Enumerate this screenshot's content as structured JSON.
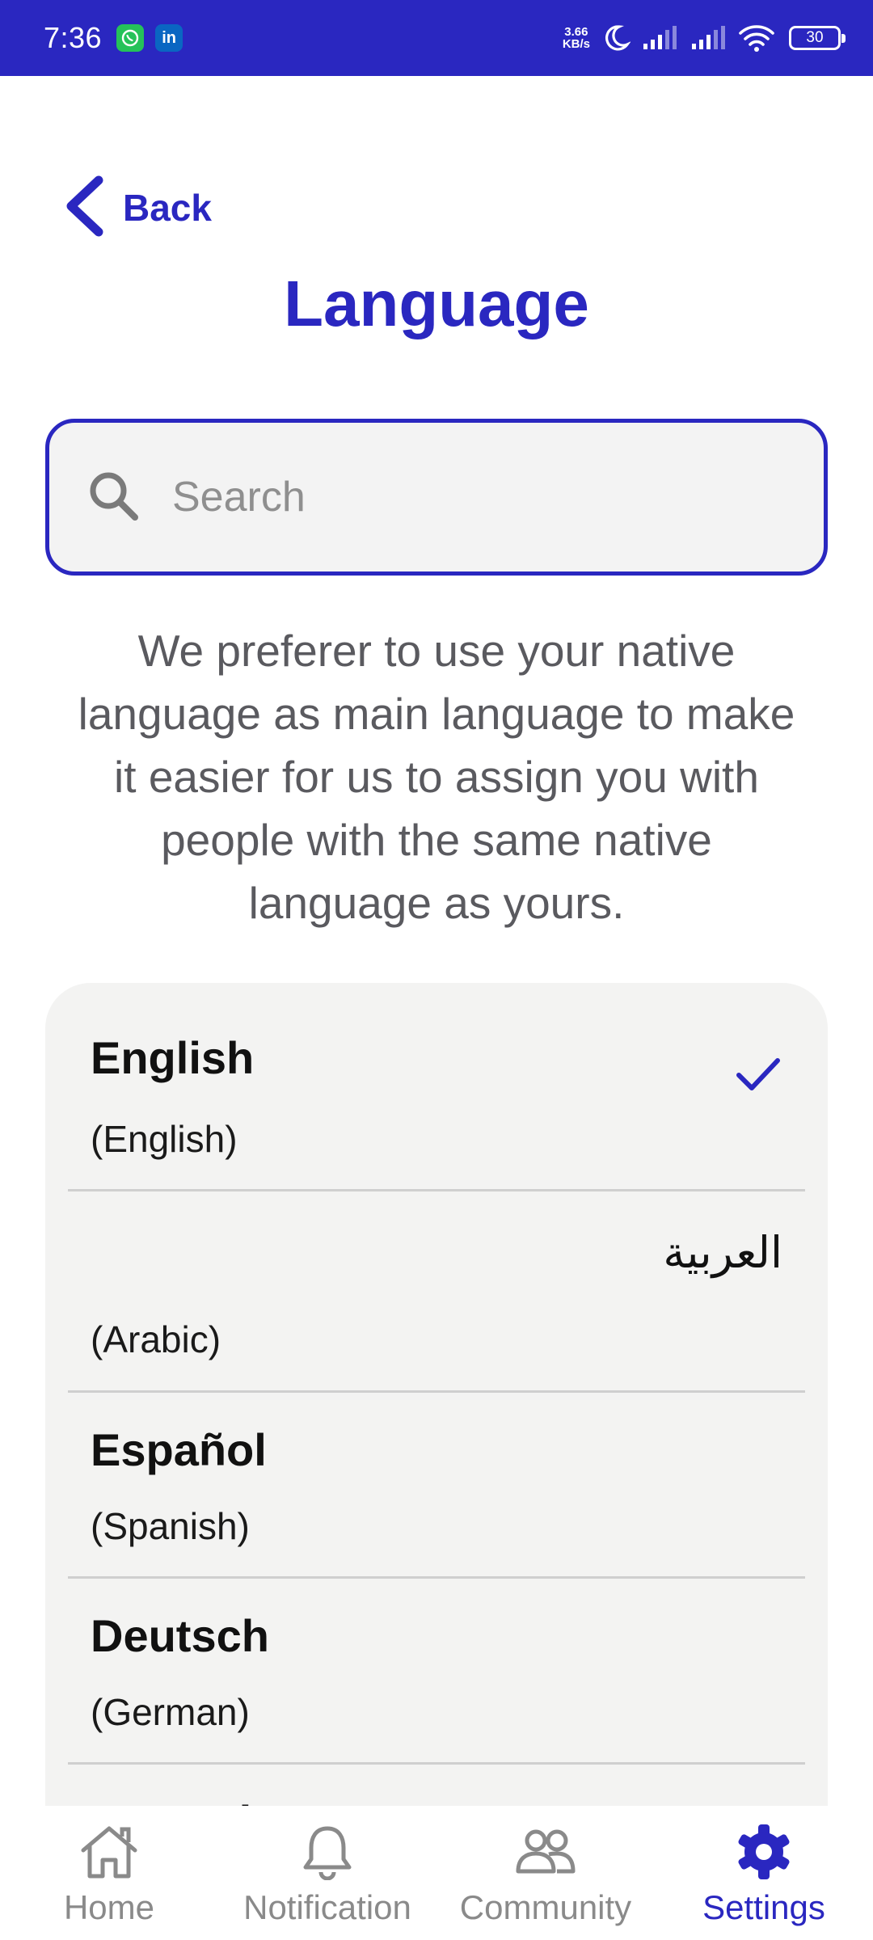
{
  "status_bar": {
    "time": "7:36",
    "net_speed_value": "3.66",
    "net_speed_unit": "KB/s",
    "battery": "30",
    "background_color": "#2a27c0",
    "icons": [
      "whatsapp-icon",
      "linkedin-icon",
      "moon-icon",
      "signal-icon",
      "signal-icon",
      "wifi-icon",
      "battery-icon"
    ]
  },
  "header": {
    "back_label": "Back",
    "title": "Language"
  },
  "search": {
    "placeholder": "Search",
    "value": ""
  },
  "description": "We preferer to use your native language as main language to make it easier for us to assign you with people with the same native language as yours.",
  "languages": [
    {
      "native": "English",
      "english": "(English)",
      "selected": true
    },
    {
      "native": "العربية",
      "english": "(Arabic)",
      "selected": false
    },
    {
      "native": "Español",
      "english": "(Spanish)",
      "selected": false
    },
    {
      "native": "Deutsch",
      "english": "(German)",
      "selected": false
    },
    {
      "native": "Français",
      "english": "",
      "selected": false
    }
  ],
  "bottom_nav": {
    "items": [
      {
        "label": "Home",
        "icon": "home-icon",
        "active": false
      },
      {
        "label": "Notification",
        "icon": "bell-icon",
        "active": false
      },
      {
        "label": "Community",
        "icon": "people-icon",
        "active": false
      },
      {
        "label": "Settings",
        "icon": "gear-icon",
        "active": true
      }
    ]
  },
  "colors": {
    "accent": "#2a27c0",
    "inactive": "#8a8a8a",
    "card_bg": "#f3f3f2",
    "text_muted": "#5a5a5f"
  }
}
